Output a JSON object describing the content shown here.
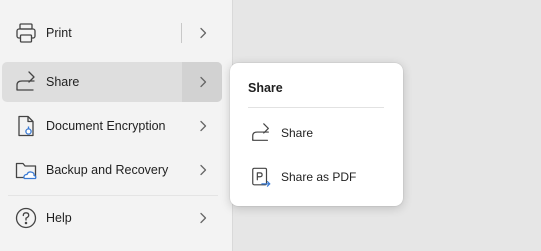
{
  "menu": {
    "items": [
      {
        "label": "Print",
        "icon": "printer-icon"
      },
      {
        "label": "Share",
        "icon": "share-icon",
        "selected": true
      },
      {
        "label": "Document Encryption",
        "icon": "document-lock-icon"
      },
      {
        "label": "Backup and Recovery",
        "icon": "cloud-folder-icon"
      },
      {
        "label": "Help",
        "icon": "help-circle-icon"
      }
    ]
  },
  "flyout": {
    "title": "Share",
    "items": [
      {
        "label": "Share",
        "icon": "share-icon"
      },
      {
        "label": "Share as PDF",
        "icon": "share-pdf-icon"
      }
    ]
  },
  "colors": {
    "panel_background": "#f3f3f3",
    "selected_background": "#dedede",
    "accent_blue": "#3a7bd5",
    "flyout_background": "#ffffff"
  }
}
